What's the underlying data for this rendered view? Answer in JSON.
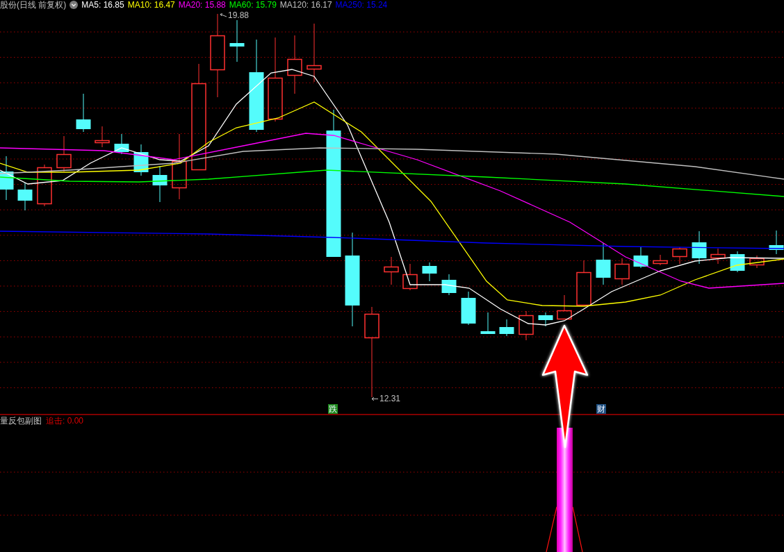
{
  "header": {
    "title": "股份(日线 前复权)",
    "indicators": [
      {
        "label": "MA5: 16.85",
        "color": "#ffffff"
      },
      {
        "label": "MA10: 16.47",
        "color": "#ffff00"
      },
      {
        "label": "MA20: 15.88",
        "color": "#ff00ff"
      },
      {
        "label": "MA60: 15.79",
        "color": "#00ff00"
      },
      {
        "label": "MA120: 16.17",
        "color": "#c0c0c0"
      },
      {
        "label": "MA250: 15.24",
        "color": "#0000ff"
      }
    ]
  },
  "chart": {
    "high_label": "19.88",
    "low_label": "12.31",
    "signals": [
      {
        "text": "跌",
        "color": "#1f8a1f"
      },
      {
        "text": "财",
        "color": "#1d4f80"
      }
    ]
  },
  "sub_panel": {
    "title": "量反包副图",
    "readout": "追击: 0.00"
  }
}
